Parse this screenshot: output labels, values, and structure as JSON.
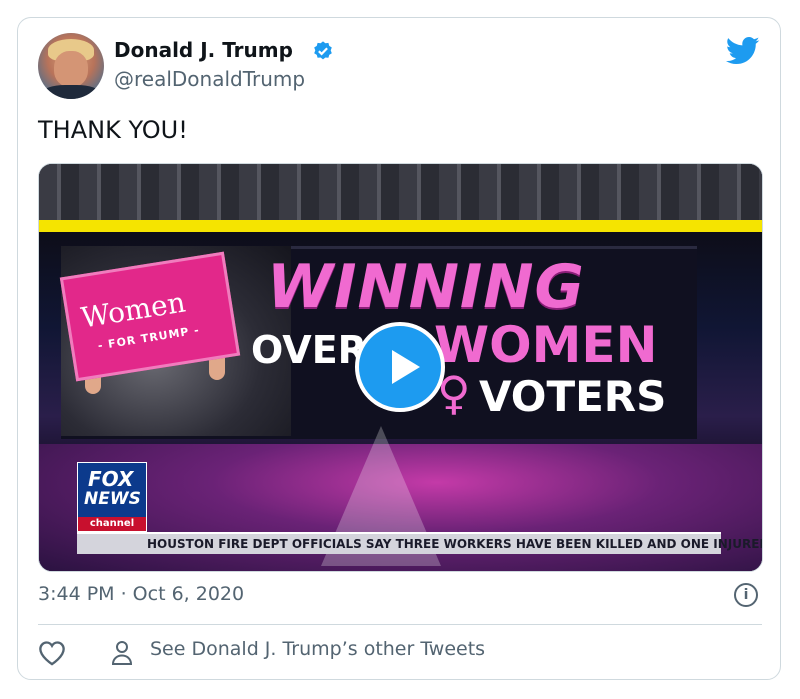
{
  "author": {
    "name": "Donald J. Trump",
    "handle": "@realDonaldTrump",
    "verified": true
  },
  "tweet": {
    "text": "THANK YOU!",
    "timestamp": "3:44 PM · Oct 6, 2020"
  },
  "video": {
    "sign_title": "Women",
    "sign_subtitle": "- FOR TRUMP -",
    "headline_line1": "WINNING",
    "headline_line2": "OVER",
    "headline_line2b": "WOMEN",
    "headline_line3": "VOTERS",
    "network_line1": "FOX",
    "network_line2": "NEWS",
    "network_line3": "channel",
    "ticker_text": "HOUSTON FIRE DEPT OFFICIALS SAY THREE WORKERS HAVE BEEN KILLED AND ONE INJURED W"
  },
  "footer": {
    "see_others_label": "See Donald J. Trump’s other Tweets"
  },
  "icons": {
    "verified": "verified-badge-icon",
    "bird": "twitter-bird-icon",
    "info": "info-icon",
    "heart": "heart-icon",
    "person": "person-icon",
    "play": "play-icon"
  },
  "colors": {
    "twitter_blue": "#1d9bf0",
    "secondary_text": "#536471",
    "border": "#cfd9de"
  }
}
